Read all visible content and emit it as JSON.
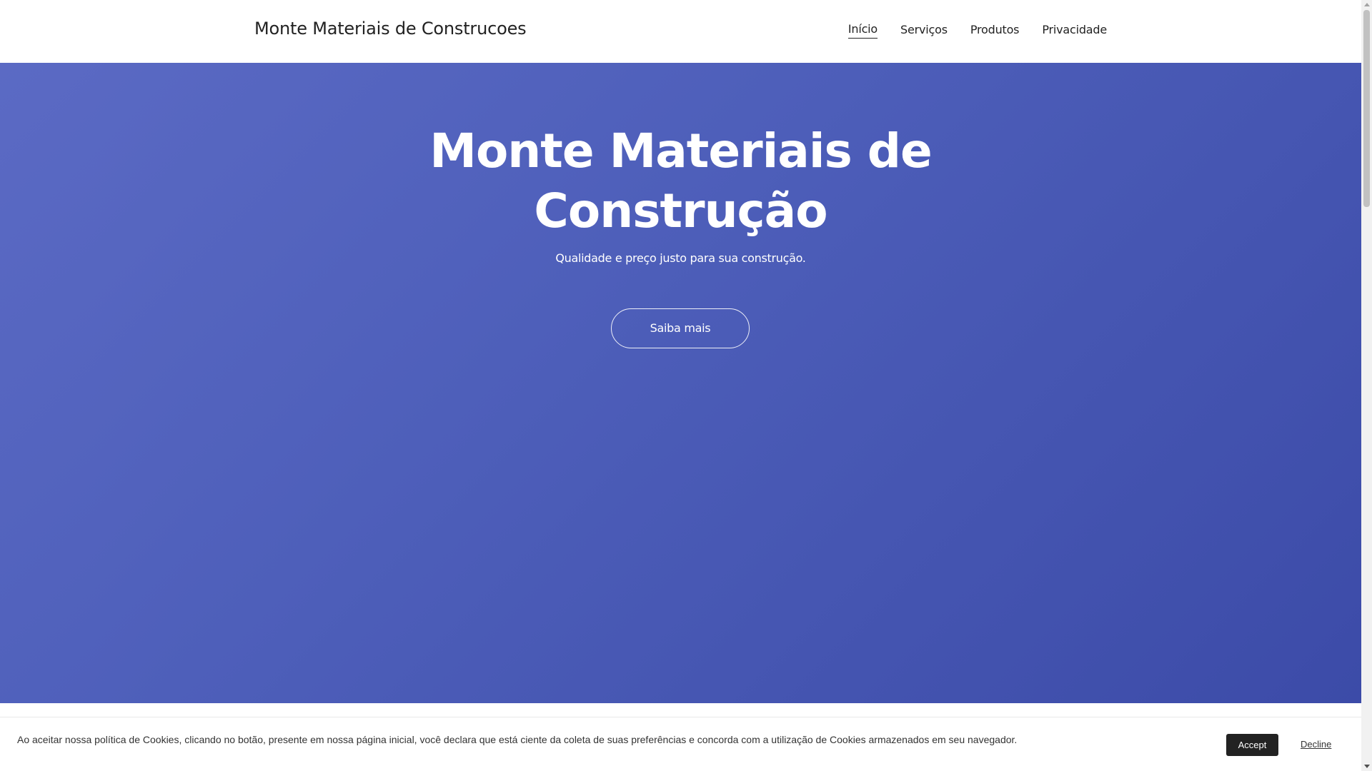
{
  "header": {
    "brand": "Monte Materiais de Construcoes",
    "nav": [
      {
        "label": "Início",
        "active": true
      },
      {
        "label": "Serviços",
        "active": false
      },
      {
        "label": "Produtos",
        "active": false
      },
      {
        "label": "Privacidade",
        "active": false
      }
    ]
  },
  "hero": {
    "title_line1": "Monte Materiais de",
    "title_line2": "Construção",
    "subtitle": "Qualidade e preço justo para sua construção.",
    "button_label": "Saiba mais",
    "gradient_colors": [
      "#5b6ac4",
      "#4e5fba",
      "#3c4ba8"
    ]
  },
  "cookie_banner": {
    "text": "Ao aceitar nossa política de Cookies, clicando no botão, presente em nossa página inicial, você declara que está ciente da coleta de suas preferências e concorda com a utilização de Cookies armazenados em seu navegador.",
    "accept_label": "Accept",
    "decline_label": "Decline"
  },
  "colors": {
    "text_dark": "#222222",
    "accept_bg": "#222222"
  }
}
